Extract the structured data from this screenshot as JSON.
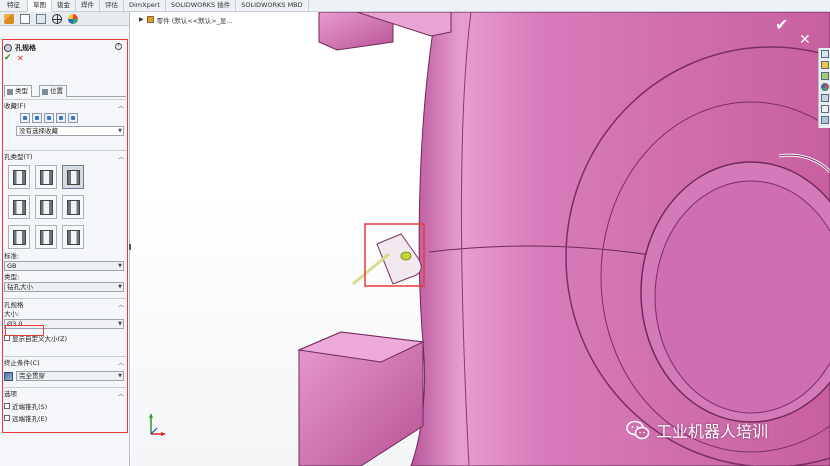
{
  "top_tabs": [
    {
      "label": "特征",
      "active": false
    },
    {
      "label": "草图",
      "active": true
    },
    {
      "label": "钣金",
      "active": false
    },
    {
      "label": "焊件",
      "active": false
    },
    {
      "label": "评估",
      "active": false
    },
    {
      "label": "DimXpert",
      "active": false
    },
    {
      "label": "SOLIDWORKS 插件",
      "active": false
    },
    {
      "label": "SOLIDWORKS MBD",
      "active": false
    }
  ],
  "panel": {
    "toolbar_icons": [
      "feature-manager-icon",
      "property-manager-icon",
      "configuration-manager-icon",
      "dimxpert-manager-icon",
      "display-manager-icon"
    ],
    "title": "孔规格",
    "help": "?",
    "ok_symbol": "✔",
    "cancel_symbol": "✕",
    "tabs": [
      {
        "label": "类型",
        "active": true
      },
      {
        "label": "位置",
        "active": false
      }
    ],
    "favorites": {
      "header": "收藏(F)",
      "selected": "没有选择收藏"
    },
    "hole_type": {
      "header": "孔类型(T)",
      "selected_index": 2,
      "count": 9
    },
    "standard": {
      "label": "标准:",
      "value": "GB"
    },
    "type": {
      "label": "类型:",
      "value": "钻孔大小"
    },
    "hole_spec": {
      "header": "孔规格",
      "size_label": "大小:",
      "size_value": "Ø3.0",
      "custom_size_label": "显示自定义大小(Z)"
    },
    "end_condition": {
      "header": "终止条件(C)",
      "value": "完全贯穿"
    },
    "options": {
      "header": "选项",
      "items": [
        "近端锥孔(S)",
        "远端锥孔(E)"
      ]
    }
  },
  "viewport": {
    "tree_flyout": "零件 (默认<<默认>_显...",
    "ok_symbol": "✔",
    "cancel_symbol": "✕",
    "accent_color": "#d277b8"
  },
  "watermark": {
    "text": "工业机器人培训"
  }
}
